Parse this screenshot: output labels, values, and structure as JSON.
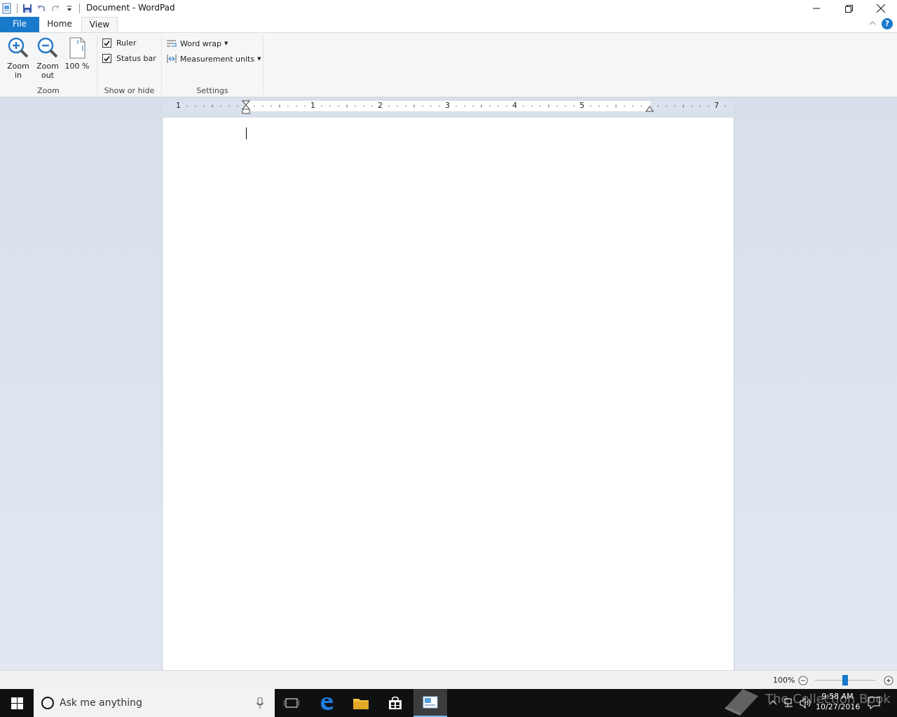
{
  "window": {
    "title": "Document - WordPad"
  },
  "tabs": {
    "file": "File",
    "home": "Home",
    "view": "View"
  },
  "ribbon": {
    "zoom_group": {
      "label": "Zoom",
      "zoom_in": "Zoom in",
      "zoom_out": "Zoom out",
      "hundred": "100 %"
    },
    "show_hide_group": {
      "label": "Show or hide",
      "ruler": "Ruler",
      "ruler_checked": true,
      "status_bar": "Status bar",
      "status_bar_checked": true
    },
    "settings_group": {
      "label": "Settings",
      "word_wrap": "Word wrap",
      "measurement_units": "Measurement units"
    }
  },
  "ruler": {
    "numbers": [
      "1",
      "1",
      "2",
      "3",
      "4",
      "5",
      "7"
    ]
  },
  "statusbar": {
    "zoom_percent": "100%",
    "zoom_level": 0.5
  },
  "taskbar": {
    "search_placeholder": "Ask me anything",
    "time": "9:58 AM",
    "date": "10/27/2016",
    "watermark": "The Collection Book"
  },
  "colors": {
    "accent": "#1979ca",
    "taskbar": "#0f1012",
    "workspace": "#d7dfea"
  }
}
